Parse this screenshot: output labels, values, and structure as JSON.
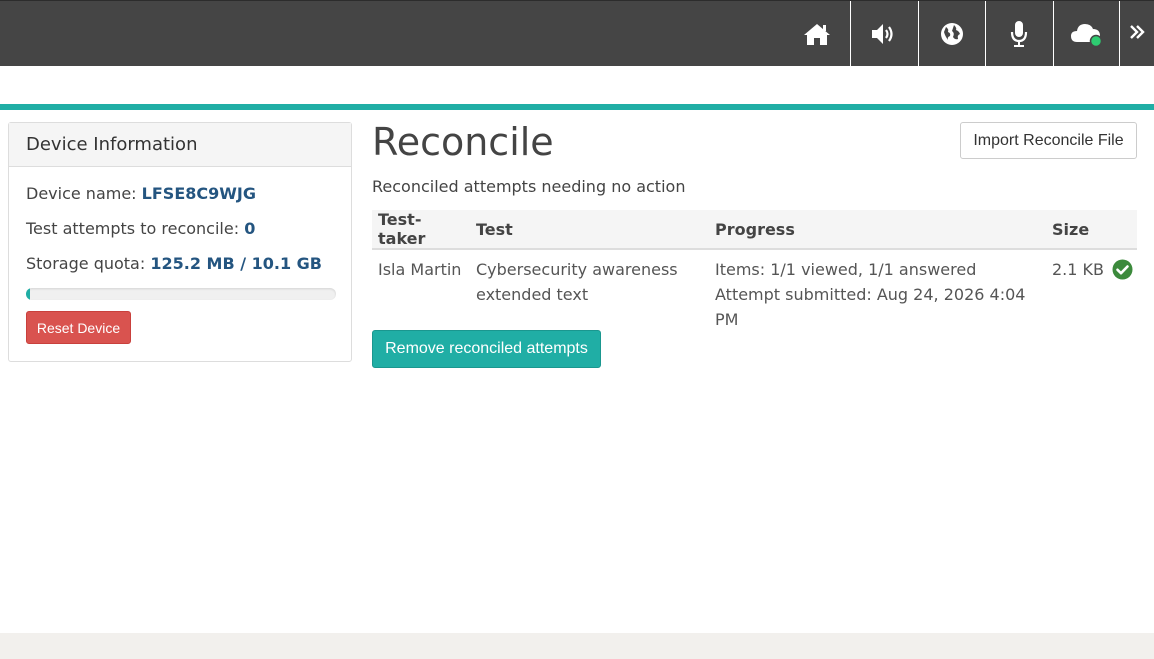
{
  "topbar": {
    "buttons": [
      {
        "icon": "home-icon"
      },
      {
        "icon": "volume-icon"
      },
      {
        "icon": "globe-icon"
      },
      {
        "icon": "microphone-icon"
      },
      {
        "icon": "cloud-icon",
        "status_color": "#2ecc71"
      }
    ],
    "more_icon": "double-chevron-right-icon"
  },
  "device_panel": {
    "title": "Device Information",
    "device_name_label": "Device name:",
    "device_name": "LFSE8C9WJG",
    "attempts_label": "Test attempts to reconcile:",
    "attempts_count": "0",
    "storage_label": "Storage quota:",
    "storage_value": "125.2 MB / 10.1 GB",
    "storage_used_fraction": 0.012,
    "reset_button": "Reset Device"
  },
  "main": {
    "title": "Reconcile",
    "import_button": "Import Reconcile File",
    "subtitle": "Reconciled attempts needing no action",
    "table": {
      "headers": [
        "Test-taker",
        "Test",
        "Progress",
        "Size"
      ],
      "rows": [
        {
          "test_taker": "Isla Martin",
          "test_line1": "Cybersecurity awareness",
          "test_line2": "extended text",
          "progress_line1": "Items: 1/1 viewed, 1/1 answered",
          "progress_line2": "Attempt submitted: Aug 24, 2026 4:04 PM",
          "size": "2.1 KB",
          "status_icon": "check-circle-icon"
        }
      ]
    },
    "remove_button": "Remove reconciled attempts"
  },
  "colors": {
    "accent": "#20aea5",
    "danger": "#d9534f",
    "topbar": "#454545",
    "success": "#3c8a3c"
  }
}
